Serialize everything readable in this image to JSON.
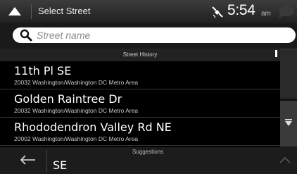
{
  "topbar": {
    "title": "Select Street",
    "time": "5:54",
    "ampm": "am",
    "icons": {
      "back": "chevron-up-icon",
      "gps": "satellite-icon",
      "messages": "speech-bubble-icon"
    }
  },
  "search": {
    "placeholder": "Street name",
    "value": ""
  },
  "history": {
    "header": "Street History",
    "items": [
      {
        "name": "11th Pl SE",
        "area": "20032 Washington/Washington DC Metro Area"
      },
      {
        "name": "Golden Raintree Dr",
        "area": "20032 Washington/Washington DC Metro Area"
      },
      {
        "name": "Rhododendron Valley Rd NE",
        "area": "20002 Washington/Washington DC Metro Area"
      }
    ]
  },
  "suggestions": {
    "label": "Suggestions",
    "text": "SE"
  },
  "colors": {
    "background": "#000000",
    "topbar": "#2a2a2a",
    "search_field": "#ffffff",
    "text": "#ffffff",
    "subtext": "#c8c8c8"
  }
}
